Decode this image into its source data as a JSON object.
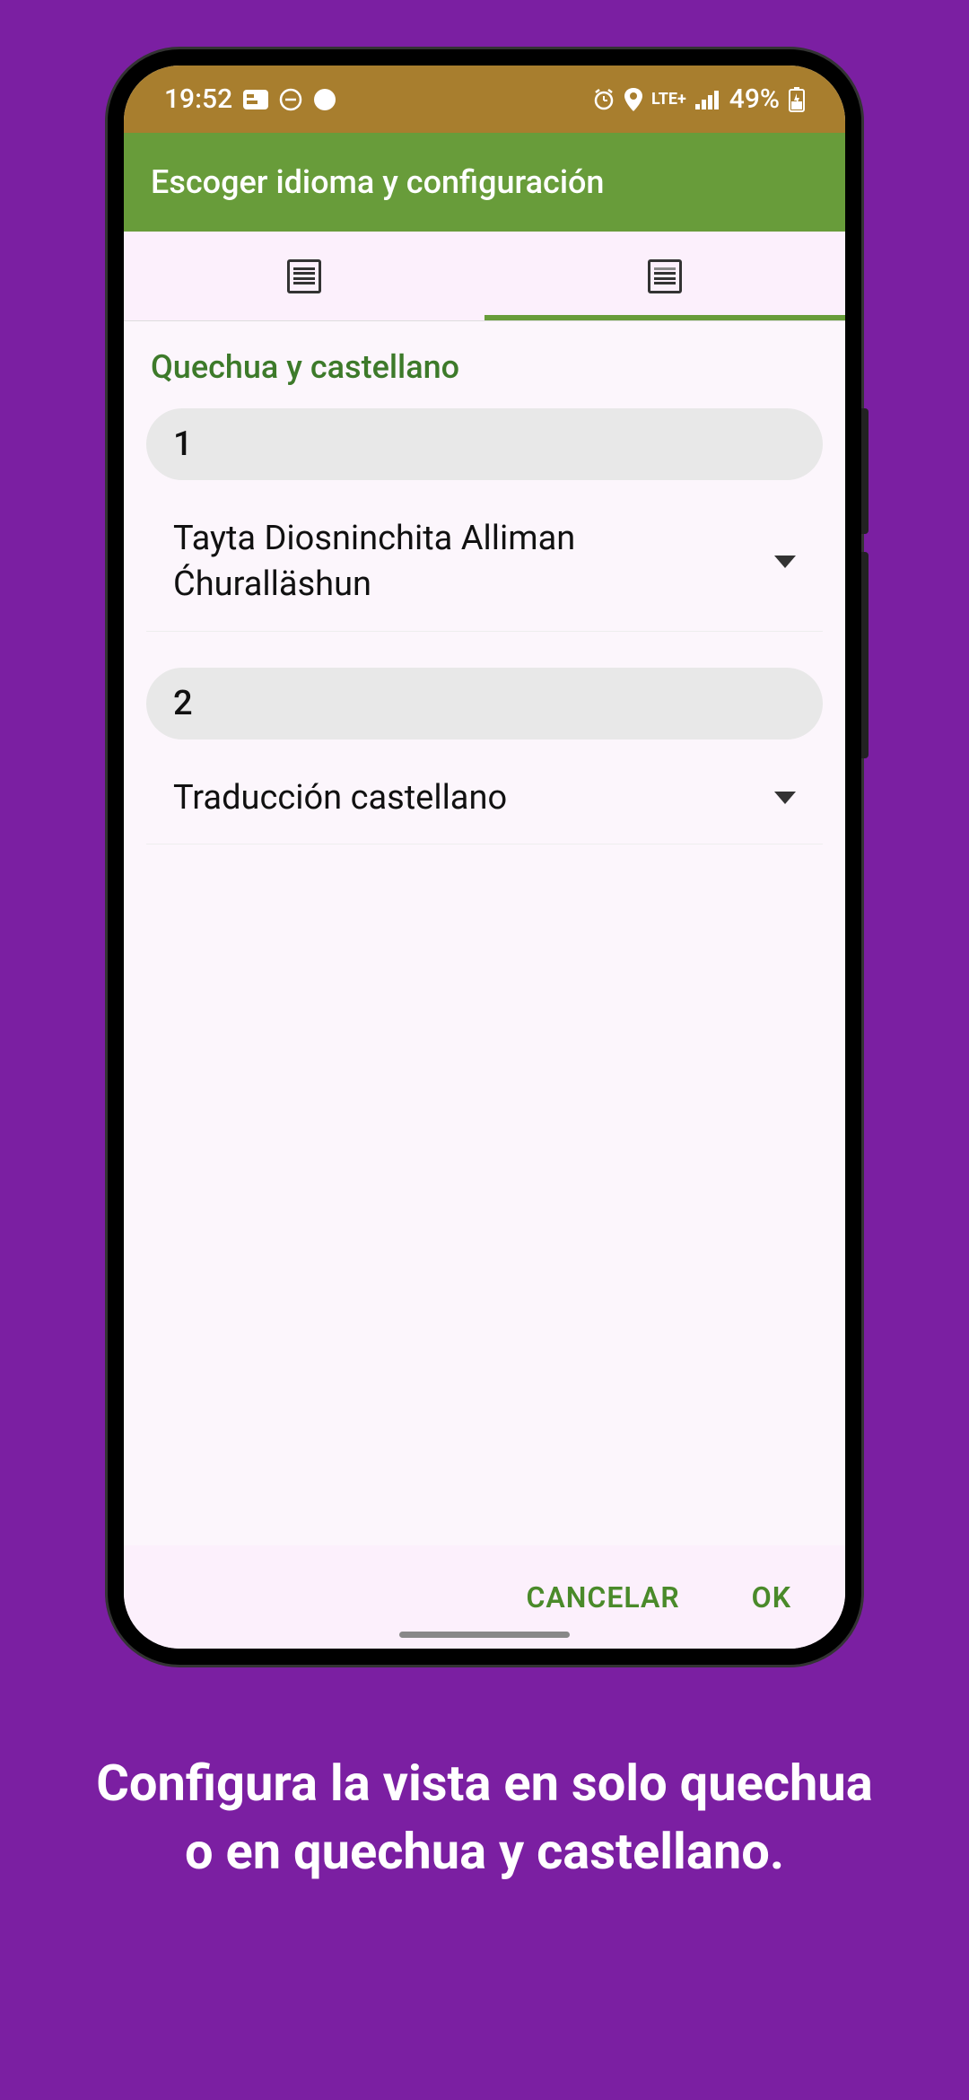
{
  "status": {
    "time": "19:52",
    "network": "LTE+",
    "battery": "49%"
  },
  "header": {
    "title": "Escoger idioma y configuración"
  },
  "section": {
    "title": "Quechua y castellano"
  },
  "items": [
    {
      "num": "1",
      "label": "Tayta Diosninchita Alliman Ćhuralläshun"
    },
    {
      "num": "2",
      "label": "Traducción castellano"
    }
  ],
  "buttons": {
    "cancel": "CANCELAR",
    "ok": "OK"
  },
  "caption": "Configura la vista en solo quechua\no en quechua y castellano."
}
